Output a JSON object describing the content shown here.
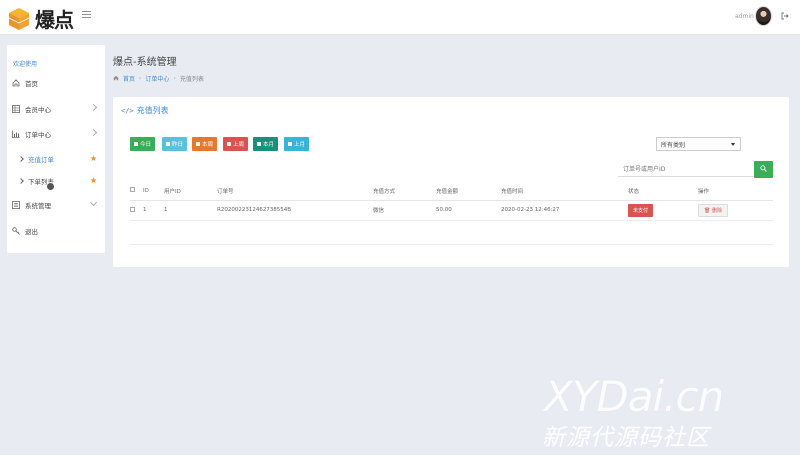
{
  "app": {
    "logo_text": "爆点",
    "user_name": "admin"
  },
  "colors": {
    "accent": "#3d8bd8",
    "green": "#3aad57",
    "red": "#d9534f",
    "orange": "#e8772e",
    "teal": "#1a8f7a",
    "cyan": "#39b3d7",
    "light_blue": "#5bc0de"
  },
  "sidebar": {
    "title": "欢迎使用",
    "items": [
      {
        "label": "首页",
        "icon": "home-icon"
      },
      {
        "label": "会员中心",
        "icon": "table-icon"
      },
      {
        "label": "订单中心",
        "icon": "bar-chart-icon"
      },
      {
        "label": "充值订单",
        "icon": "chevron-right-icon"
      },
      {
        "label": "下单列表",
        "icon": "chevron-right-icon"
      },
      {
        "label": "系统管理",
        "icon": "document-icon"
      },
      {
        "label": "退出",
        "icon": "key-icon"
      }
    ]
  },
  "page": {
    "title": "爆点-系统管理",
    "breadcrumb": [
      "首页",
      "订单中心",
      "充值列表"
    ]
  },
  "card": {
    "title": "充值列表",
    "filters": [
      "今日",
      "昨日",
      "本周",
      "上周",
      "本月",
      "上月"
    ],
    "select_value": "所有类别",
    "search_placeholder": "订单号或用户ID"
  },
  "table": {
    "headers": [
      "ID",
      "用户ID",
      "订单号",
      "充值方式",
      "充值金额",
      "充值时间",
      "状态",
      "操作"
    ],
    "rows": [
      {
        "id": "1",
        "user_id": "1",
        "order_no": "R2020022312462738554B",
        "method": "微信",
        "amount": "50.00",
        "time": "2020-02-23 12:46:27",
        "status": "未支付",
        "action": "删除"
      }
    ]
  },
  "watermark": {
    "line1": "XYDai.cn",
    "line2": "新源代源码社区"
  }
}
